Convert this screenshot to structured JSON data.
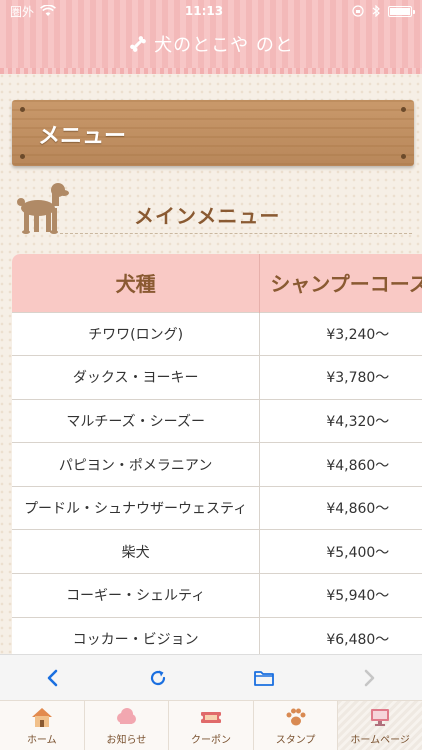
{
  "status_bar": {
    "carrier": "圏外",
    "time": "11:13"
  },
  "app": {
    "title": "犬のとこや のと"
  },
  "header_board": {
    "title": "メニュー"
  },
  "section": {
    "title": "メインメニュー"
  },
  "table": {
    "headers": [
      "犬種",
      "シャンプーコース"
    ],
    "rows": [
      {
        "breed": "チワワ(ロング)",
        "price": "¥3,240〜"
      },
      {
        "breed": "ダックス・ヨーキー",
        "price": "¥3,780〜"
      },
      {
        "breed": "マルチーズ・シーズー",
        "price": "¥4,320〜"
      },
      {
        "breed": "パピヨン・ポメラニアン",
        "price": "¥4,860〜"
      },
      {
        "breed": "プードル・シュナウザーウェスティ",
        "price": "¥4,860〜"
      },
      {
        "breed": "柴犬",
        "price": "¥5,400〜"
      },
      {
        "breed": "コーギー・シェルティ",
        "price": "¥5,940〜"
      },
      {
        "breed": "コッカー・ビジョン",
        "price": "¥6,480〜"
      }
    ]
  },
  "browser_toolbar": {
    "icons": [
      "chevron-left-icon",
      "reload-icon",
      "folder-icon",
      "chevron-right-icon"
    ]
  },
  "tabs": [
    {
      "label": "ホーム",
      "icon": "house-icon"
    },
    {
      "label": "お知らせ",
      "icon": "cloud-icon"
    },
    {
      "label": "クーポン",
      "icon": "coupon-icon"
    },
    {
      "label": "スタンプ",
      "icon": "paw-icon"
    },
    {
      "label": "ホームページ",
      "icon": "monitor-icon"
    }
  ],
  "colors": {
    "header_pink": "#f7c6c6",
    "table_header": "#f9c9c5",
    "accent_brown": "#8a5a32",
    "toolbar_blue": "#1a6fe0"
  }
}
